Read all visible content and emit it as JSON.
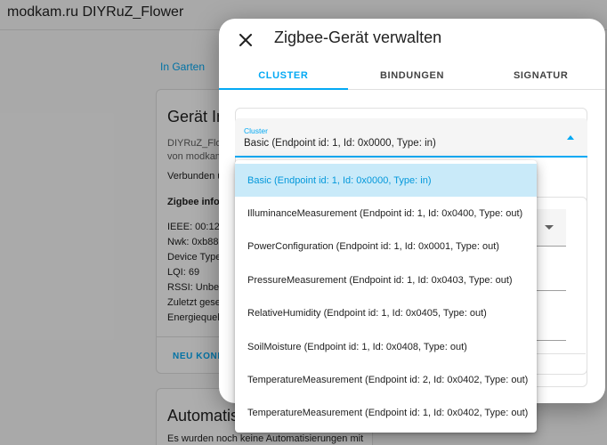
{
  "page": {
    "title": "modkam.ru DIYRuZ_Flower"
  },
  "background": {
    "breadcrumb": "In Garten",
    "device_card": {
      "title": "Gerät In",
      "model": "DIYRuZ_Flo",
      "manufacturer": "von modkam",
      "connected": "Verbunden ü",
      "zigbee_info_heading": "Zigbee info",
      "info_lines": [
        "IEEE: 00:12:4",
        "Nwk: 0xb88e",
        "Device Type",
        "LQI: 69",
        "RSSI: Unbek",
        "Zuletzt gese",
        "Energiequell"
      ],
      "action": "NEU KONF"
    },
    "automation_card": {
      "title": "Automatis",
      "text": "Es wurden noch keine Automatisierungen mit"
    }
  },
  "dialog": {
    "title": "Zigbee-Gerät verwalten",
    "tabs": [
      {
        "label": "CLUSTER",
        "active": true
      },
      {
        "label": "BINDUNGEN",
        "active": false
      },
      {
        "label": "SIGNATUR",
        "active": false
      }
    ],
    "cluster_select": {
      "label": "Cluster",
      "value": "Basic (Endpoint id: 1, Id: 0x0000, Type: in)"
    },
    "options": [
      "Basic (Endpoint id: 1, Id: 0x0000, Type: in)",
      "IlluminanceMeasurement (Endpoint id: 1, Id: 0x0400, Type: out)",
      "PowerConfiguration (Endpoint id: 1, Id: 0x0001, Type: out)",
      "PressureMeasurement (Endpoint id: 1, Id: 0x0403, Type: out)",
      "RelativeHumidity (Endpoint id: 1, Id: 0x0405, Type: out)",
      "SoilMoisture (Endpoint id: 1, Id: 0x0408, Type: out)",
      "TemperatureMeasurement (Endpoint id: 2, Id: 0x0402, Type: out)",
      "TemperatureMeasurement (Endpoint id: 1, Id: 0x0402, Type: out)"
    ],
    "selected_option_index": 0
  },
  "colors": {
    "accent": "#03a9f4",
    "selected_bg": "#c9eaf9"
  },
  "icons": {
    "close": "close-icon",
    "dropdown": "arrow-up-icon"
  }
}
